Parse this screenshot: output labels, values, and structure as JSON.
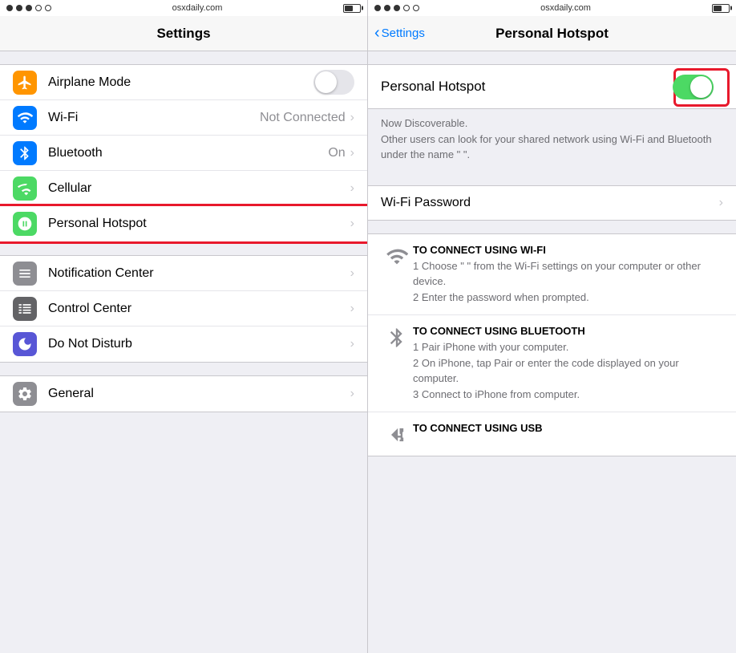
{
  "left": {
    "statusBar": {
      "dots": [
        true,
        true,
        true,
        false,
        false
      ],
      "title": "osxdaily.com",
      "battery": "medium"
    },
    "navBar": {
      "title": "Settings"
    },
    "sections": [
      {
        "id": "connectivity",
        "rows": [
          {
            "id": "airplane-mode",
            "label": "Airplane Mode",
            "iconBg": "bg-orange",
            "icon": "airplane",
            "hasToggle": true,
            "toggleOn": false,
            "value": "",
            "hasChevron": false
          },
          {
            "id": "wifi",
            "label": "Wi-Fi",
            "iconBg": "bg-blue",
            "icon": "wifi",
            "hasToggle": false,
            "value": "Not Connected",
            "hasChevron": true
          },
          {
            "id": "bluetooth",
            "label": "Bluetooth",
            "iconBg": "bg-bluetooth",
            "icon": "bluetooth",
            "hasToggle": false,
            "value": "On",
            "hasChevron": true
          },
          {
            "id": "cellular",
            "label": "Cellular",
            "iconBg": "bg-green",
            "icon": "cellular",
            "hasToggle": false,
            "value": "",
            "hasChevron": true
          },
          {
            "id": "personal-hotspot",
            "label": "Personal Hotspot",
            "iconBg": "bg-green",
            "icon": "hotspot",
            "hasToggle": false,
            "value": "",
            "hasChevron": true,
            "highlighted": true
          }
        ]
      },
      {
        "id": "system",
        "rows": [
          {
            "id": "notification-center",
            "label": "Notification Center",
            "iconBg": "bg-gray",
            "icon": "notification",
            "hasToggle": false,
            "value": "",
            "hasChevron": true
          },
          {
            "id": "control-center",
            "label": "Control Center",
            "iconBg": "bg-dark-gray",
            "icon": "control",
            "hasToggle": false,
            "value": "",
            "hasChevron": true
          },
          {
            "id": "do-not-disturb",
            "label": "Do Not Disturb",
            "iconBg": "bg-indigo",
            "icon": "moon",
            "hasToggle": false,
            "value": "",
            "hasChevron": true
          }
        ]
      },
      {
        "id": "general",
        "rows": [
          {
            "id": "general",
            "label": "General",
            "iconBg": "bg-gray",
            "icon": "gear",
            "hasToggle": false,
            "value": "",
            "hasChevron": true
          }
        ]
      }
    ]
  },
  "right": {
    "statusBar": {
      "dots": [
        true,
        true,
        true,
        false,
        false
      ],
      "title": "osxdaily.com"
    },
    "navBar": {
      "backLabel": "Settings",
      "title": "Personal Hotspot"
    },
    "hotspot": {
      "label": "Personal Hotspot",
      "toggleOn": true,
      "discoverableText": "Now Discoverable.\nOther users can look for your shared network using Wi-Fi and Bluetooth under the name “                ”."
    },
    "wifiPassword": {
      "label": "Wi-Fi Password"
    },
    "connectMethods": [
      {
        "id": "wifi",
        "heading": "TO CONNECT USING WI-FI",
        "body": "1 Choose “                ” from the Wi-Fi settings on your computer or other device.\n2 Enter the password when prompted."
      },
      {
        "id": "bluetooth",
        "heading": "TO CONNECT USING BLUETOOTH",
        "body": "1 Pair iPhone with your computer.\n2 On iPhone, tap Pair or enter the code displayed on your computer.\n3 Connect to iPhone from computer."
      },
      {
        "id": "usb",
        "heading": "TO CONNECT USING USB",
        "body": ""
      }
    ]
  }
}
